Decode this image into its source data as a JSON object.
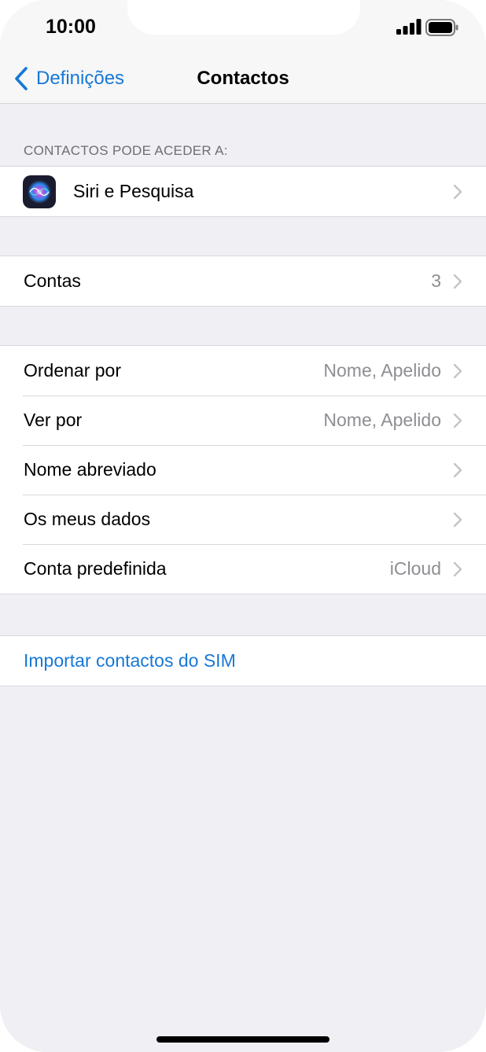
{
  "status_bar": {
    "time": "10:00"
  },
  "nav": {
    "back_label": "Definições",
    "title": "Contactos"
  },
  "section_header": "CONTACTOS PODE ACEDER A:",
  "siri_row": {
    "label": "Siri e Pesquisa",
    "icon": "siri-icon"
  },
  "accounts_row": {
    "label": "Contas",
    "value": "3"
  },
  "settings_rows": [
    {
      "label": "Ordenar por",
      "value": "Nome, Apelido"
    },
    {
      "label": "Ver por",
      "value": "Nome, Apelido"
    },
    {
      "label": "Nome abreviado",
      "value": ""
    },
    {
      "label": "Os meus dados",
      "value": ""
    },
    {
      "label": "Conta predefinida",
      "value": "iCloud"
    }
  ],
  "import_row": {
    "label": "Importar contactos do SIM"
  },
  "colors": {
    "accent": "#1778d6",
    "background": "#efeff4",
    "secondary_text": "#8e8e93"
  }
}
